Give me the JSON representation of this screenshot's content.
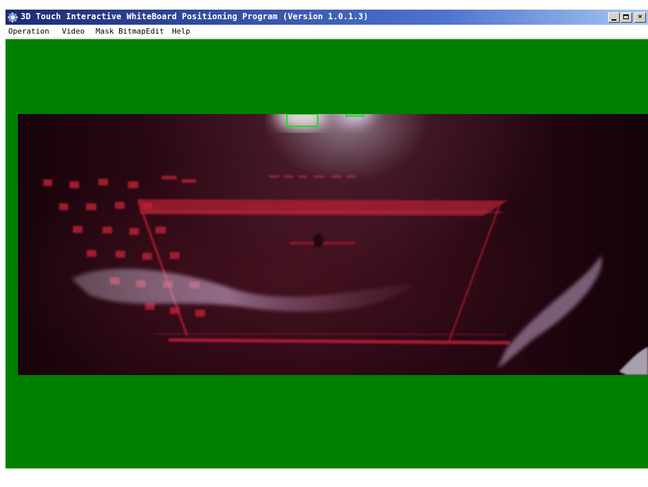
{
  "window": {
    "title": "3D Touch Interactive WhiteBoard Positioning Program (Version 1.0.1.3)",
    "controls": {
      "minimize": "_",
      "maximize": "□",
      "close": "×"
    }
  },
  "menu": {
    "items": [
      {
        "label": "Operation"
      },
      {
        "label": "Video"
      },
      {
        "label": "Mask Bitmap"
      },
      {
        "label": "Edit"
      },
      {
        "label": "Help"
      }
    ]
  },
  "colors": {
    "title_bar": "#1b2b74",
    "title_text": "#ffffff",
    "menu_background": "#ffffff",
    "client_background": "#008000",
    "camera_red": "#c21f35",
    "detection_box": "#23d62d"
  },
  "icons": {
    "app": "interactive-whiteboard-icon",
    "minimize": "minimize-icon",
    "maximize": "maximize-icon",
    "close": "close-icon"
  },
  "video": {
    "content": "infrared camera view with two detected light regions"
  }
}
